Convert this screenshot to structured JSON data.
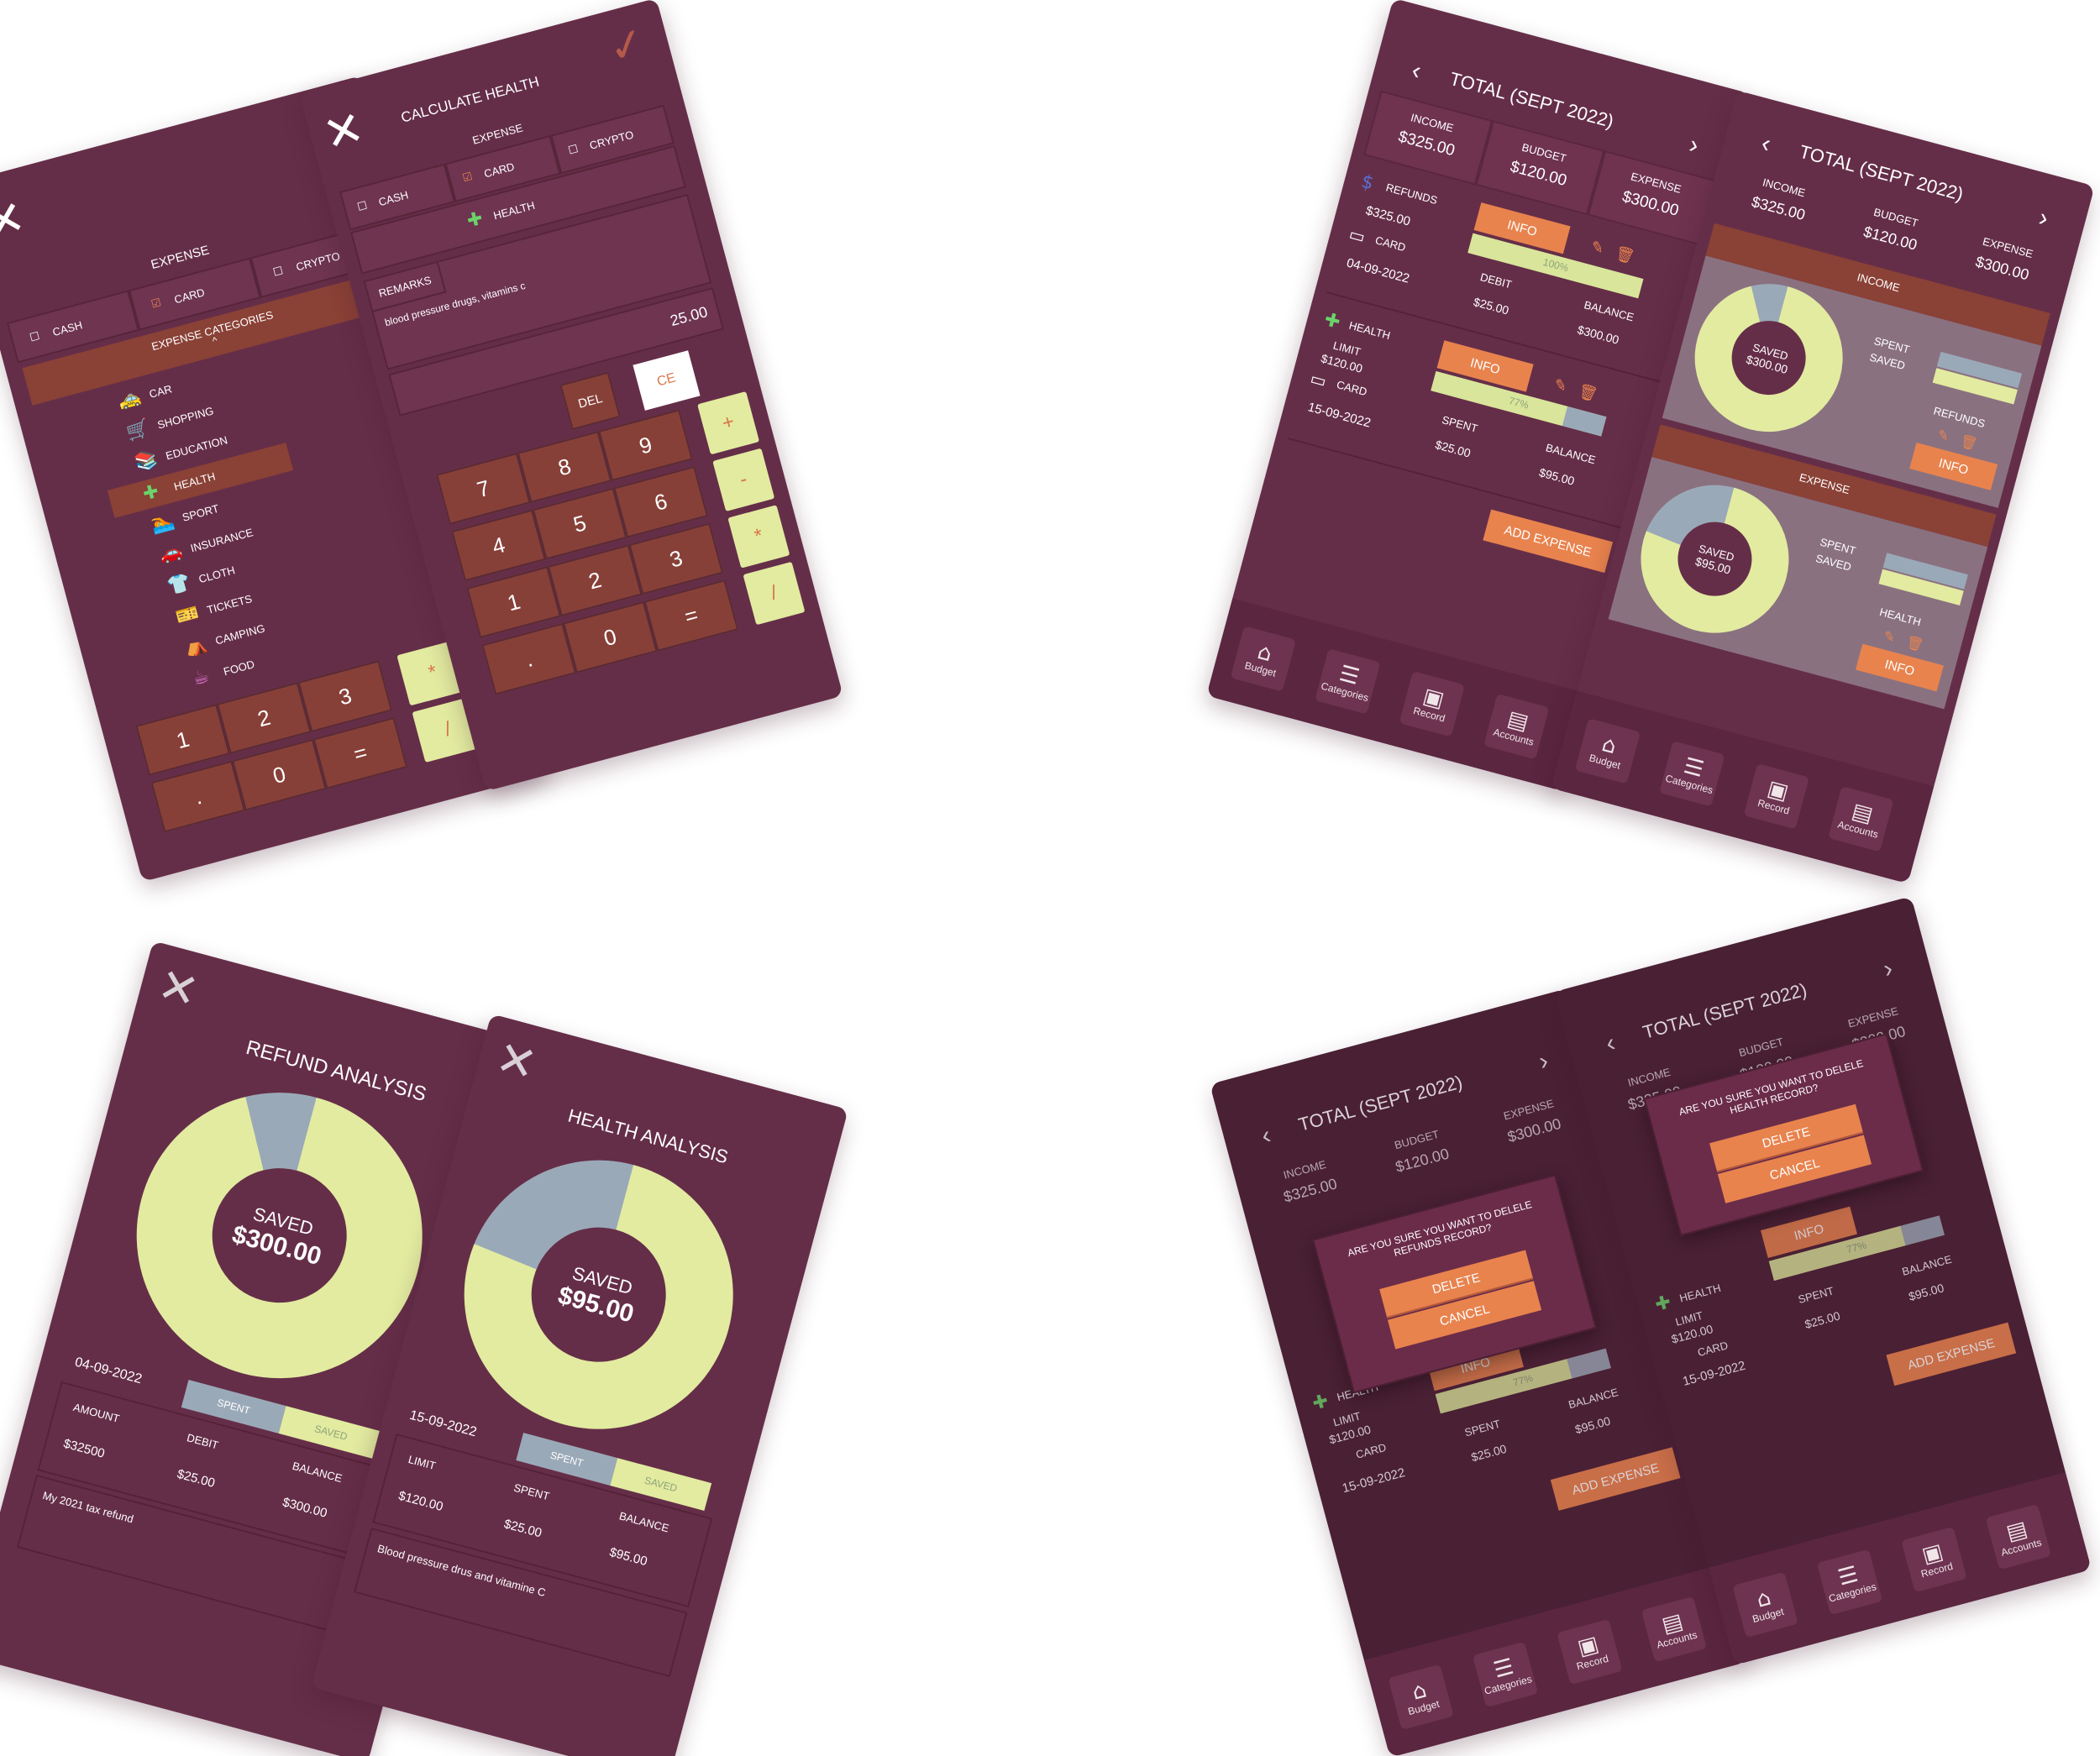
{
  "calc_category": {
    "expense_label": "EXPENSE",
    "cash": "CASH",
    "card": "CARD",
    "crypto": "CRYPTO",
    "categories_header": "EXPENSE CATEGORIES",
    "categories": [
      {
        "label": "CAR",
        "icon": "car-icon",
        "glyph": "🚕"
      },
      {
        "label": "SHOPPING",
        "icon": "cart-icon",
        "glyph": "🛒"
      },
      {
        "label": "EDUCATION",
        "icon": "education-icon",
        "glyph": "📚"
      },
      {
        "label": "HEALTH",
        "icon": "medkit-icon",
        "glyph": "✚"
      },
      {
        "label": "SPORT",
        "icon": "swim-icon",
        "glyph": "🏊"
      },
      {
        "label": "INSURANCE",
        "icon": "car-crash-icon",
        "glyph": "🚗"
      },
      {
        "label": "CLOTH",
        "icon": "shirt-icon",
        "glyph": "👕"
      },
      {
        "label": "TICKETS",
        "icon": "ticket-icon",
        "glyph": "🎫"
      },
      {
        "label": "CAMPING",
        "icon": "tent-icon",
        "glyph": "⛺"
      },
      {
        "label": "FOOD",
        "icon": "cup-icon",
        "glyph": "☕"
      }
    ],
    "keys_row1": [
      "1",
      "2",
      "3"
    ],
    "keys_row2": [
      ".",
      "0",
      "="
    ],
    "ops": [
      "*",
      "/"
    ]
  },
  "calc_health": {
    "title": "CALCULATE HEALTH",
    "expense_label": "EXPENSE",
    "cash": "CASH",
    "card": "CARD",
    "crypto": "CRYPTO",
    "category": "HEALTH",
    "remarks_label": "REMARKS",
    "remarks": "blood pressure drugs, vitamins c",
    "amount": "25.00",
    "del": "DEL",
    "ce": "CE",
    "keys": [
      [
        "7",
        "8",
        "9"
      ],
      [
        "4",
        "5",
        "6"
      ],
      [
        "1",
        "2",
        "3"
      ],
      [
        ".",
        "0",
        "="
      ]
    ],
    "ops": [
      "+",
      "-",
      "*",
      "/"
    ]
  },
  "total": {
    "title": "TOTAL (SEPT 2022)",
    "income_label": "INCOME",
    "income": "$325.00",
    "budget_label": "BUDGET",
    "budget": "$120.00",
    "expense_label": "EXPENSE",
    "expense": "$300.00",
    "refunds": {
      "label": "REFUNDS",
      "amount": "$325.00",
      "card": "CARD",
      "date": "04-09-2022",
      "info": "INFO",
      "percent": "100%",
      "percent_value": 1.0,
      "debit_label": "DEBIT",
      "debit": "$25.00",
      "balance_label": "BALANCE",
      "balance": "$300.00"
    },
    "health": {
      "label": "HEALTH",
      "limit_label": "LIMIT",
      "limit": "$120.00",
      "card": "CARD",
      "date": "15-09-2022",
      "info": "INFO",
      "percent": "77%",
      "percent_value": 0.77,
      "spent_label": "SPENT",
      "spent": "$25.00",
      "balance_label": "BALANCE",
      "balance": "$95.00"
    },
    "add_expense": "ADD EXPENSE"
  },
  "nav": [
    {
      "label": "Budget",
      "icon": "home-icon",
      "glyph": "⌂"
    },
    {
      "label": "Categories",
      "icon": "layers-icon",
      "glyph": "☰"
    },
    {
      "label": "Record",
      "icon": "wallet-icon",
      "glyph": "▣"
    },
    {
      "label": "Accounts",
      "icon": "receipt-icon",
      "glyph": "▤"
    }
  ],
  "overview": {
    "income_section": "INCOME",
    "income_saved": "SAVED",
    "income_saved_amount": "$300.00",
    "spent": "SPENT",
    "saved": "SAVED",
    "refunds": "REFUNDS",
    "info": "INFO",
    "expense_section": "EXPENSE",
    "expense_saved": "SAVED",
    "expense_saved_amount": "$95.00",
    "health": "HEALTH"
  },
  "refund_analysis": {
    "title": "REFUND ANALYSIS",
    "saved_label": "SAVED",
    "saved": "$300.00",
    "saved_fraction": 0.92,
    "date": "04-09-2022",
    "spent": "SPENT",
    "saved_tag": "SAVED",
    "amount_label": "AMOUNT",
    "amount": "$32500",
    "debit_label": "DEBIT",
    "debit": "$25.00",
    "balance_label": "BALANCE",
    "balance": "$300.00",
    "note": "My 2021 tax refund"
  },
  "health_analysis": {
    "title": "HEALTH ANALYSIS",
    "saved_label": "SAVED",
    "saved": "$95.00",
    "saved_fraction": 0.77,
    "date": "15-09-2022",
    "spent": "SPENT",
    "saved_tag": "SAVED",
    "limit_label": "LIMIT",
    "limit": "$120.00",
    "spent_label": "SPENT",
    "spent_amount": "$25.00",
    "balance_label": "BALANCE",
    "balance": "$95.00",
    "note": "Blood pressure drus and vitamine C"
  },
  "delete_refunds": {
    "question": "ARE YOU SURE YOU WANT TO DELELE REFUNDS RECORD?",
    "delete": "DELETE",
    "cancel": "CANCEL"
  },
  "delete_health": {
    "question": "ARE YOU SURE YOU WANT TO DELELE HEALTH RECORD?",
    "delete": "DELETE",
    "cancel": "CANCEL"
  },
  "colors": {
    "background": "#652e48",
    "accent": "#e8834e",
    "highlight": "#874038",
    "lime": "#e2eba0",
    "slate": "#9aa9b8"
  }
}
